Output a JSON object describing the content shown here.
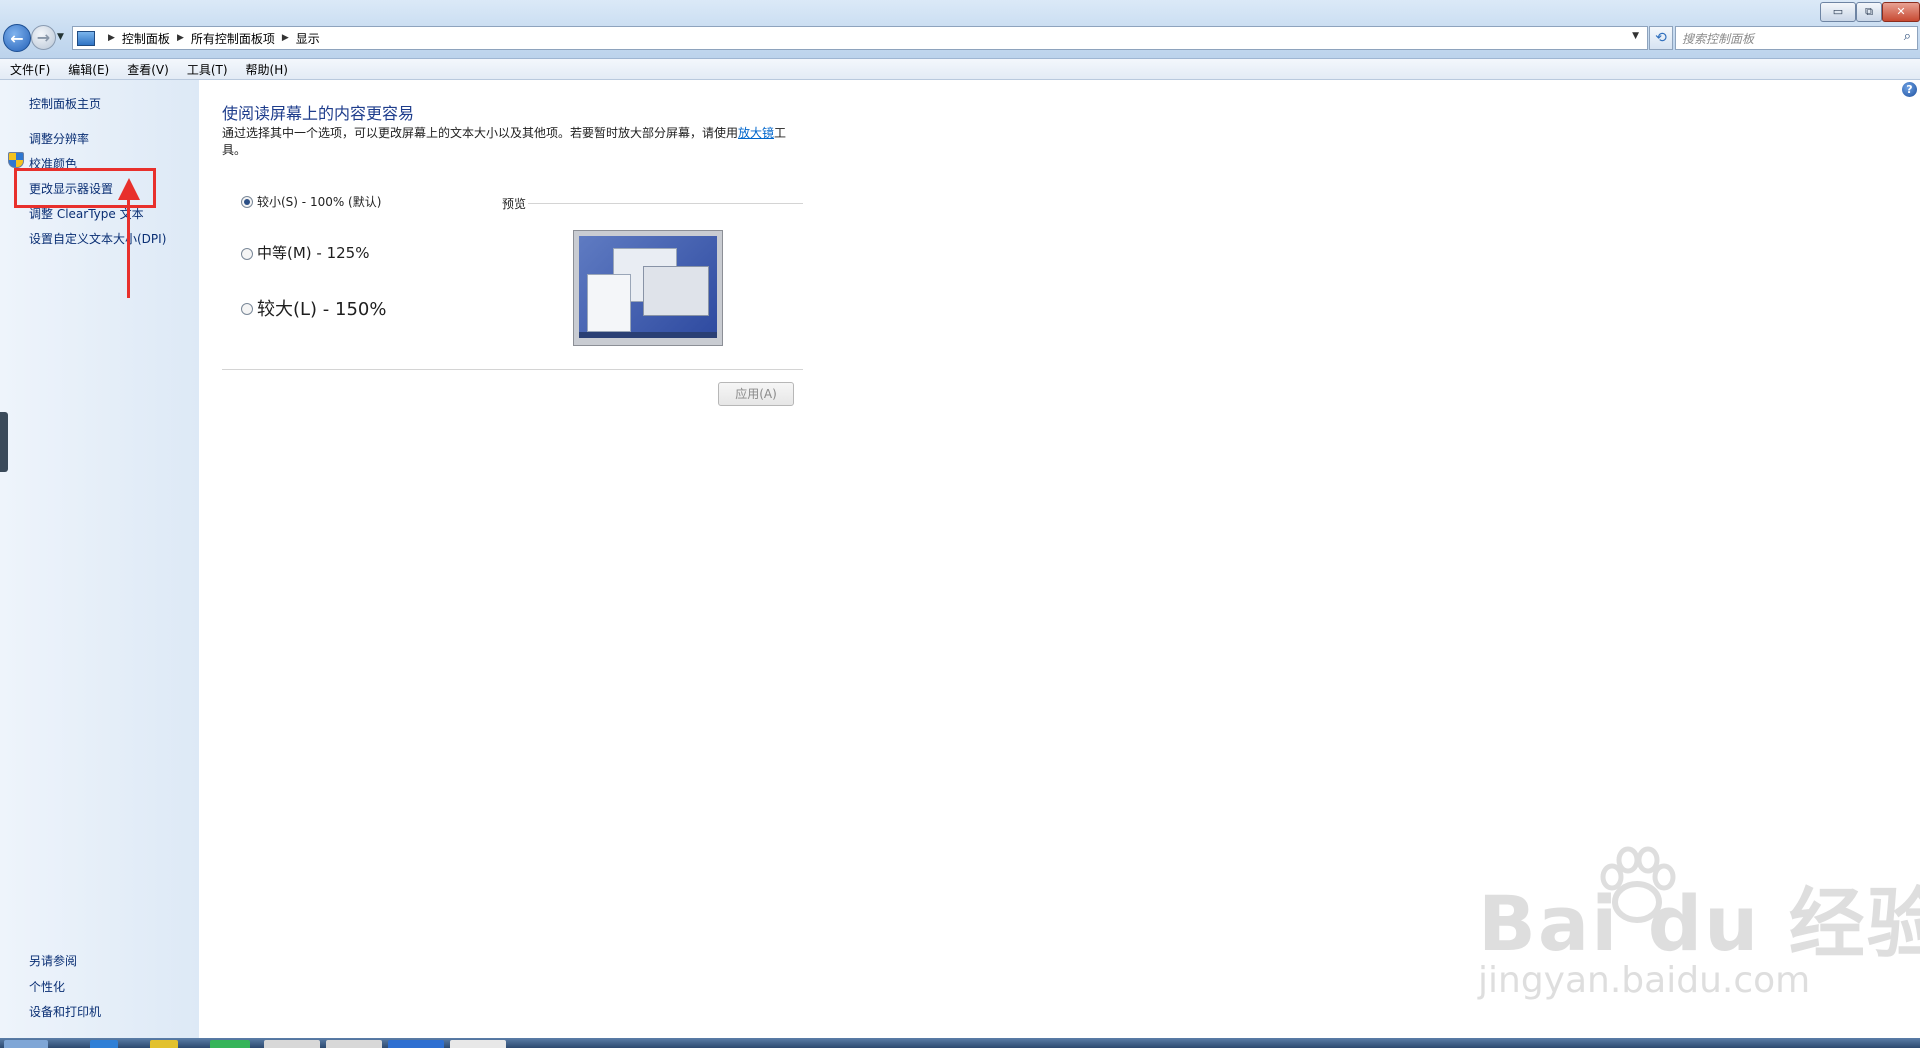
{
  "window": {
    "breadcrumb": [
      "控制面板",
      "所有控制面板项",
      "显示"
    ],
    "search_placeholder": "搜索控制面板",
    "controls": {
      "minimize": "▭",
      "maximize": "⧉",
      "close": "✕"
    }
  },
  "menu": [
    "文件(F)",
    "编辑(E)",
    "查看(V)",
    "工具(T)",
    "帮助(H)"
  ],
  "sidebar": {
    "home": "控制面板主页",
    "links": [
      "调整分辨率",
      "校准颜色",
      "更改显示器设置",
      "调整 ClearType 文本",
      "设置自定义文本大小(DPI)"
    ],
    "see_also_title": "另请参阅",
    "see_also": [
      "个性化",
      "设备和打印机"
    ]
  },
  "main": {
    "title": "使阅读屏幕上的内容更容易",
    "description_prefix": "通过选择其中一个选项，可以更改屏幕上的文本大小以及其他项。若要暂时放大部分屏幕，请使用",
    "magnifier_link": "放大镜",
    "description_suffix": "工具。",
    "options": [
      {
        "label": "较小(S) - 100% (默认)",
        "checked": true
      },
      {
        "label": "中等(M) - 125%",
        "checked": false
      },
      {
        "label": "较大(L) - 150%",
        "checked": false
      }
    ],
    "preview_label": "预览",
    "apply_button": "应用(A)"
  },
  "watermark": {
    "brand": "Bai  du 经验",
    "url": "jingyan.baidu.com"
  },
  "colors": {
    "link": "#0a2f74",
    "title": "#1e3d8c",
    "annotation": "#e8302c"
  },
  "icons": [
    "back-arrow-icon",
    "forward-arrow-icon",
    "control-panel-icon",
    "refresh-icon",
    "search-icon",
    "help-icon",
    "shield-icon",
    "paw-icon"
  ]
}
